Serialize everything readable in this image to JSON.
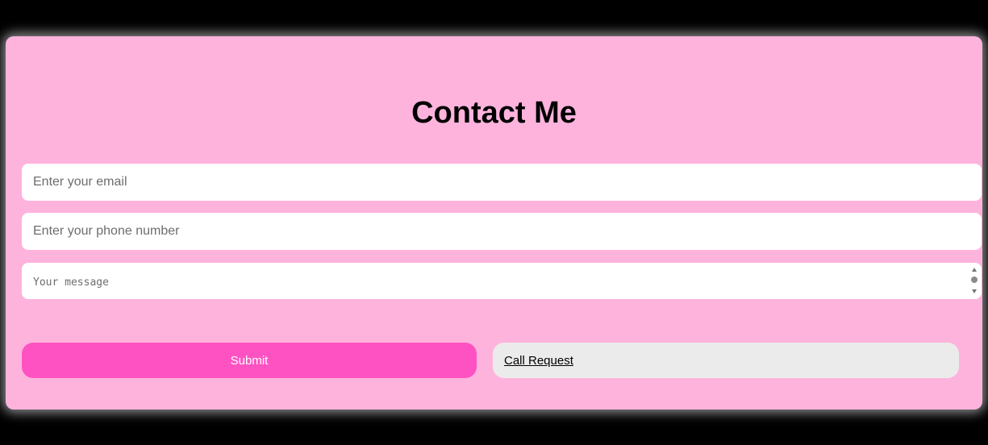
{
  "title": "Contact Me",
  "form": {
    "email_placeholder": "Enter your email",
    "phone_placeholder": "Enter your phone number",
    "message_placeholder": "Your message"
  },
  "buttons": {
    "submit_label": "Submit",
    "call_label": "Call Request"
  },
  "colors": {
    "card_background": "#feb3dd",
    "submit_background": "#ff52c2",
    "call_background": "#ebebeb",
    "page_background": "#000000"
  }
}
